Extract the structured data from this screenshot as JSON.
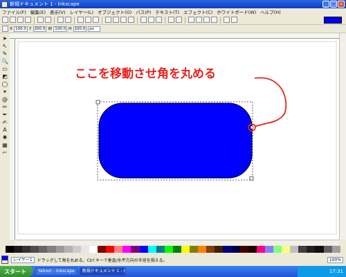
{
  "window": {
    "title": "新規ドキュメント 1 - Inkscape"
  },
  "menu": [
    "ファイル(F)",
    "編集(E)",
    "表示(V)",
    "レイヤー(L)",
    "オブジェクト(O)",
    "パス(P)",
    "テキスト(T)",
    "エフェクト(C)",
    "ホワイトボード(W)",
    "ヘルプ(H)"
  ],
  "toolbar2": {
    "x_label": "X",
    "x_value": "100.0",
    "y_label": "Y",
    "y_value": "200.0",
    "w_label": "W",
    "w_value": "100.0",
    "h_label": "H",
    "h_value": "100.0",
    "unit": "px"
  },
  "annotation": {
    "text": "ここを移動させ角を丸める",
    "color": "#e8231b"
  },
  "shape": {
    "fill": "#0000ff"
  },
  "palette_colors": [
    "#000000",
    "#1a1a1a",
    "#333333",
    "#4d4d4d",
    "#666666",
    "#808080",
    "#999999",
    "#b3b3b3",
    "#cccccc",
    "#e6e6e6",
    "#ffffff",
    "#800000",
    "#ff0000",
    "#ff8080",
    "#ff00ff",
    "#800080",
    "#0000ff",
    "#00ffff",
    "#008080",
    "#00ff00",
    "#008000",
    "#ffff00",
    "#808000",
    "#ff8000",
    "#804000",
    "#402000",
    "#000080",
    "#000040",
    "#400000",
    "#200000",
    "#ff0080",
    "#8080ff",
    "#80ff80",
    "#ffff80",
    "#c0c0c0",
    "#404040",
    "#202020",
    "#101010",
    "#606060",
    "#a0a0a0"
  ],
  "status": {
    "layer_label": "レイヤー1",
    "message": "ドラッグして角を丸める。Ctrl キーで垂直/水平方向の半径を揃える。",
    "zoom": "100%"
  },
  "taskbar": {
    "start_label": "スタート",
    "tasks": [
      "Yahoo! - Inkscape",
      "新規ドキュメント 1 - Ink..."
    ],
    "time": "17:31"
  }
}
